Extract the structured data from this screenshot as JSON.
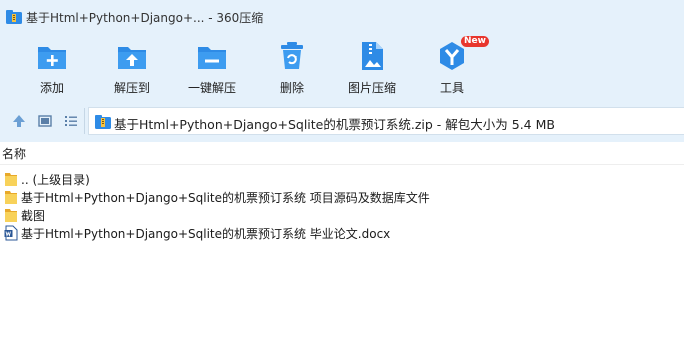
{
  "window": {
    "title": "基于Html+Python+Django+... - 360压缩",
    "icon": "archive-app-icon"
  },
  "toolbar": {
    "items": [
      {
        "label": "添加",
        "icon": "folder-add-icon"
      },
      {
        "label": "解压到",
        "icon": "folder-extract-icon"
      },
      {
        "label": "一键解压",
        "icon": "folder-minus-icon"
      },
      {
        "label": "删除",
        "icon": "trash-icon"
      },
      {
        "label": "图片压缩",
        "icon": "image-zip-icon"
      },
      {
        "label": "工具",
        "icon": "tools-icon",
        "badge": "New"
      }
    ]
  },
  "address": {
    "path_text": "基于Html+Python+Django+Sqlite的机票预订系统.zip - 解包大小为 5.4 MB",
    "buttons": [
      "up-arrow-icon",
      "thumbnail-view-icon",
      "list-view-icon"
    ]
  },
  "file_list": {
    "column_name": "名称",
    "rows": [
      {
        "label": ".. (上级目录)",
        "icon": "folder-icon"
      },
      {
        "label": "基于Html+Python+Django+Sqlite的机票预订系统 项目源码及数据库文件",
        "icon": "folder-icon"
      },
      {
        "label": "截图",
        "icon": "folder-icon"
      },
      {
        "label": "基于Html+Python+Django+Sqlite的机票预订系统 毕业论文.docx",
        "icon": "word-doc-icon"
      }
    ]
  },
  "colors": {
    "chrome_bg": "#e5f1fb",
    "icon_blue": "#2e8be6",
    "folder_yellow": "#f5c342",
    "badge_red": "#e8362d"
  }
}
